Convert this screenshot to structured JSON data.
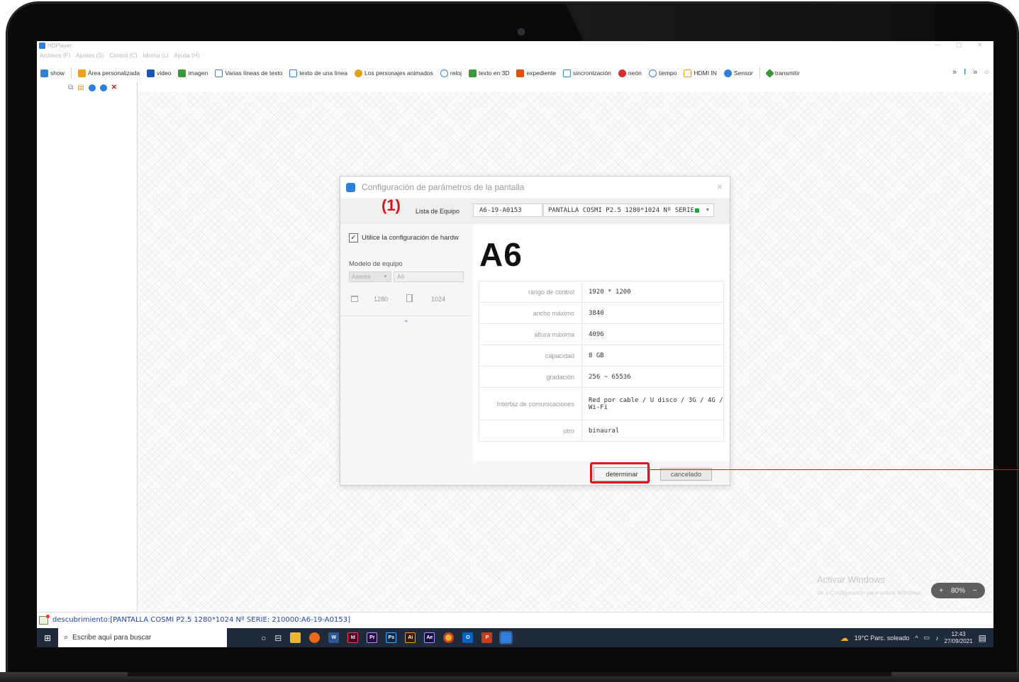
{
  "app": {
    "title": "HDPlayer",
    "menu": [
      "Archivos (F)",
      "Ajustes (S)",
      "Control (C)",
      "Idioma (L)",
      "Ayuda (H)"
    ]
  },
  "toolbar": {
    "items": [
      {
        "label": "show",
        "color": "#2f7fd9"
      },
      {
        "label": "Área personalizada",
        "color": "#f0a020"
      },
      {
        "label": "video",
        "color": "#1a56b8"
      },
      {
        "label": "imagen",
        "color": "#3a9a3a"
      },
      {
        "label": "Varias líneas de texto",
        "color": "#2f7fd9"
      },
      {
        "label": "texto de una línea",
        "color": "#2f7fd9"
      },
      {
        "label": "Los personajes animados",
        "color": "#e0a020"
      },
      {
        "label": "reloj",
        "color": "#2f7fd9"
      },
      {
        "label": "texto en 3D",
        "color": "#3a9a3a"
      },
      {
        "label": "expediente",
        "color": "#e05010"
      },
      {
        "label": "sincronización",
        "color": "#2f7fd9"
      },
      {
        "label": "neón",
        "color": "#d83030"
      },
      {
        "label": "tiempo",
        "color": "#2f7fd9"
      },
      {
        "label": "HDMI IN",
        "color": "#e0a020"
      },
      {
        "label": "Sensor",
        "color": "#2f7fd9"
      },
      {
        "label": "transmitir",
        "color": "#3a9a3a"
      }
    ],
    "more": "»"
  },
  "dialog": {
    "title": "Configuración de parámetros de la pantalla",
    "close": "×",
    "step": "(1)",
    "device_list_label": "Lista de Equipo",
    "device_id": "A6-19-A0153",
    "device_name": "PANTALLA COSMI P2.5 1280*1024 Nº SERIE",
    "use_hw_config": "Utilice la configuración de hardw",
    "model_label": "Modelo de equipo",
    "series": "Aseries",
    "model": "A6",
    "width": "1280",
    "height": "1024",
    "model_big": "A6",
    "specs": [
      {
        "k": "rango de control",
        "v": "1920 * 1200"
      },
      {
        "k": "ancho máximo",
        "v": "3840"
      },
      {
        "k": "altura máxima",
        "v": "4096"
      },
      {
        "k": "capacidad",
        "v": "8 GB"
      },
      {
        "k": "gradación",
        "v": "256 ~ 65536"
      },
      {
        "k": "Interfaz de comunicaciones",
        "v": "Red por cable / U disco / 3G / 4G / Wi-Fi"
      },
      {
        "k": "otro",
        "v": "binaural"
      }
    ],
    "ok": "determinar",
    "cancel": "cancelado"
  },
  "canvas": {
    "watermark_title": "Activar Windows",
    "watermark_sub": "Ve a Configuración para activar Windows.",
    "zoom_minus": "+",
    "zoom_value": "80%",
    "zoom_plus": "−"
  },
  "status": {
    "text": "descubrimiento:[PANTALLA COSMI P2.5 1280*1024 Nº SERIE: 210000:A6-19-A0153]"
  },
  "taskbar": {
    "search_placeholder": "Escribe aquí para buscar",
    "weather": "19°C  Parc. soleado",
    "time": "12:43",
    "date": "27/09/2021",
    "apps": [
      {
        "label": "W",
        "color": "#2b5797"
      },
      {
        "label": "Id",
        "color": "#49021f"
      },
      {
        "label": "Pr",
        "color": "#2a0a4a"
      },
      {
        "label": "Ps",
        "color": "#0a2a4a"
      },
      {
        "label": "Ai",
        "color": "#3a1a00"
      },
      {
        "label": "Ae",
        "color": "#1a0a3a"
      },
      {
        "label": "O",
        "color": "#d04020"
      },
      {
        "label": "P",
        "color": "#c43e1c"
      }
    ]
  }
}
